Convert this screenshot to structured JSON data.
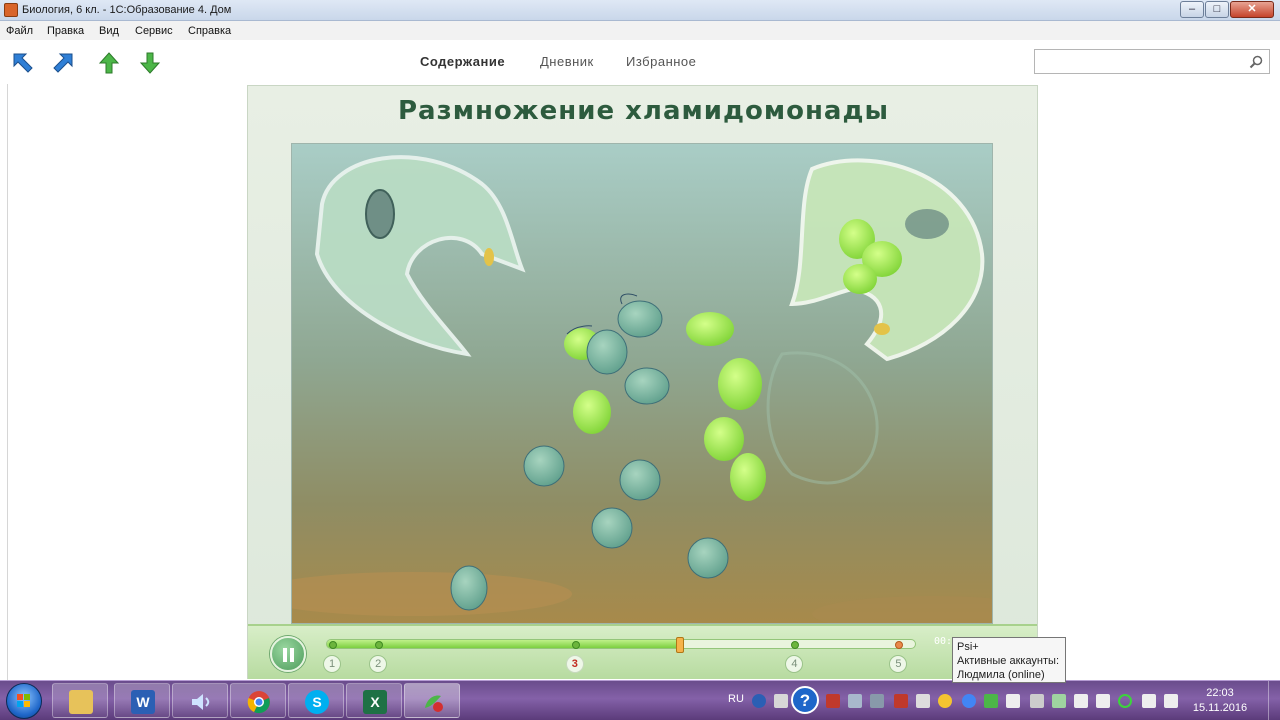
{
  "window": {
    "title": "Биология, 6 кл. - 1С:Образование 4. Дом",
    "controls": {
      "minimize": "–",
      "maximize": "□",
      "close": "✕"
    }
  },
  "menu": [
    "Файл",
    "Правка",
    "Вид",
    "Сервис",
    "Справка"
  ],
  "toolbar": {
    "icons": [
      "back-arrow-icon",
      "forward-arrow-icon",
      "up-arrow-icon",
      "down-arrow-icon"
    ],
    "nav": [
      {
        "label": "Содержание",
        "active": true
      },
      {
        "label": "Дневник",
        "active": false
      },
      {
        "label": "Избранное",
        "active": false
      }
    ],
    "search": {
      "value": "",
      "placeholder": ""
    }
  },
  "lesson": {
    "title": "Размножение  хламидомонады"
  },
  "player": {
    "state": "playing",
    "progress": 0.6,
    "chapters": [
      {
        "label": "1",
        "position": 0.0,
        "current": false
      },
      {
        "label": "2",
        "position": 0.08,
        "current": false
      },
      {
        "label": "3",
        "position": 0.42,
        "current": true
      },
      {
        "label": "4",
        "position": 0.8,
        "current": false
      },
      {
        "label": "5",
        "position": 0.98,
        "current": false
      }
    ],
    "timecode": "00:"
  },
  "tooltip": {
    "lines": [
      "Psi+",
      "Активные аккаунты:",
      "Людмила (online)"
    ]
  },
  "taskbar": {
    "apps": [
      {
        "name": "explorer",
        "glyph": ""
      },
      {
        "name": "word",
        "glyph": "W"
      },
      {
        "name": "media",
        "glyph": ""
      },
      {
        "name": "chrome",
        "glyph": ""
      },
      {
        "name": "skype",
        "glyph": "S"
      },
      {
        "name": "excel",
        "glyph": "X"
      },
      {
        "name": "1c-education",
        "glyph": ""
      }
    ],
    "language": "RU",
    "clock": {
      "time": "22:03",
      "date": "15.11.2016"
    }
  },
  "colors": {
    "title_green": "#2d5b3e",
    "taskbar_purple": "#7a5a9c",
    "cell_green": "#9be05a",
    "accent_blue": "#1e66c9"
  }
}
